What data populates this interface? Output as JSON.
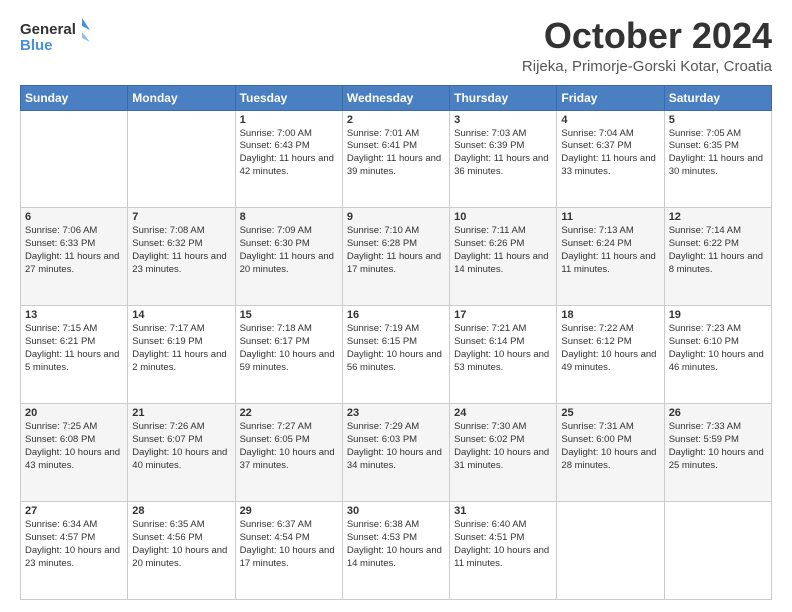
{
  "header": {
    "logo_line1": "General",
    "logo_line2": "Blue",
    "title": "October 2024",
    "subtitle": "Rijeka, Primorje-Gorski Kotar, Croatia"
  },
  "weekdays": [
    "Sunday",
    "Monday",
    "Tuesday",
    "Wednesday",
    "Thursday",
    "Friday",
    "Saturday"
  ],
  "weeks": [
    [
      {
        "day": "",
        "info": ""
      },
      {
        "day": "",
        "info": ""
      },
      {
        "day": "1",
        "info": "Sunrise: 7:00 AM\nSunset: 6:43 PM\nDaylight: 11 hours and 42 minutes."
      },
      {
        "day": "2",
        "info": "Sunrise: 7:01 AM\nSunset: 6:41 PM\nDaylight: 11 hours and 39 minutes."
      },
      {
        "day": "3",
        "info": "Sunrise: 7:03 AM\nSunset: 6:39 PM\nDaylight: 11 hours and 36 minutes."
      },
      {
        "day": "4",
        "info": "Sunrise: 7:04 AM\nSunset: 6:37 PM\nDaylight: 11 hours and 33 minutes."
      },
      {
        "day": "5",
        "info": "Sunrise: 7:05 AM\nSunset: 6:35 PM\nDaylight: 11 hours and 30 minutes."
      }
    ],
    [
      {
        "day": "6",
        "info": "Sunrise: 7:06 AM\nSunset: 6:33 PM\nDaylight: 11 hours and 27 minutes."
      },
      {
        "day": "7",
        "info": "Sunrise: 7:08 AM\nSunset: 6:32 PM\nDaylight: 11 hours and 23 minutes."
      },
      {
        "day": "8",
        "info": "Sunrise: 7:09 AM\nSunset: 6:30 PM\nDaylight: 11 hours and 20 minutes."
      },
      {
        "day": "9",
        "info": "Sunrise: 7:10 AM\nSunset: 6:28 PM\nDaylight: 11 hours and 17 minutes."
      },
      {
        "day": "10",
        "info": "Sunrise: 7:11 AM\nSunset: 6:26 PM\nDaylight: 11 hours and 14 minutes."
      },
      {
        "day": "11",
        "info": "Sunrise: 7:13 AM\nSunset: 6:24 PM\nDaylight: 11 hours and 11 minutes."
      },
      {
        "day": "12",
        "info": "Sunrise: 7:14 AM\nSunset: 6:22 PM\nDaylight: 11 hours and 8 minutes."
      }
    ],
    [
      {
        "day": "13",
        "info": "Sunrise: 7:15 AM\nSunset: 6:21 PM\nDaylight: 11 hours and 5 minutes."
      },
      {
        "day": "14",
        "info": "Sunrise: 7:17 AM\nSunset: 6:19 PM\nDaylight: 11 hours and 2 minutes."
      },
      {
        "day": "15",
        "info": "Sunrise: 7:18 AM\nSunset: 6:17 PM\nDaylight: 10 hours and 59 minutes."
      },
      {
        "day": "16",
        "info": "Sunrise: 7:19 AM\nSunset: 6:15 PM\nDaylight: 10 hours and 56 minutes."
      },
      {
        "day": "17",
        "info": "Sunrise: 7:21 AM\nSunset: 6:14 PM\nDaylight: 10 hours and 53 minutes."
      },
      {
        "day": "18",
        "info": "Sunrise: 7:22 AM\nSunset: 6:12 PM\nDaylight: 10 hours and 49 minutes."
      },
      {
        "day": "19",
        "info": "Sunrise: 7:23 AM\nSunset: 6:10 PM\nDaylight: 10 hours and 46 minutes."
      }
    ],
    [
      {
        "day": "20",
        "info": "Sunrise: 7:25 AM\nSunset: 6:08 PM\nDaylight: 10 hours and 43 minutes."
      },
      {
        "day": "21",
        "info": "Sunrise: 7:26 AM\nSunset: 6:07 PM\nDaylight: 10 hours and 40 minutes."
      },
      {
        "day": "22",
        "info": "Sunrise: 7:27 AM\nSunset: 6:05 PM\nDaylight: 10 hours and 37 minutes."
      },
      {
        "day": "23",
        "info": "Sunrise: 7:29 AM\nSunset: 6:03 PM\nDaylight: 10 hours and 34 minutes."
      },
      {
        "day": "24",
        "info": "Sunrise: 7:30 AM\nSunset: 6:02 PM\nDaylight: 10 hours and 31 minutes."
      },
      {
        "day": "25",
        "info": "Sunrise: 7:31 AM\nSunset: 6:00 PM\nDaylight: 10 hours and 28 minutes."
      },
      {
        "day": "26",
        "info": "Sunrise: 7:33 AM\nSunset: 5:59 PM\nDaylight: 10 hours and 25 minutes."
      }
    ],
    [
      {
        "day": "27",
        "info": "Sunrise: 6:34 AM\nSunset: 4:57 PM\nDaylight: 10 hours and 23 minutes."
      },
      {
        "day": "28",
        "info": "Sunrise: 6:35 AM\nSunset: 4:56 PM\nDaylight: 10 hours and 20 minutes."
      },
      {
        "day": "29",
        "info": "Sunrise: 6:37 AM\nSunset: 4:54 PM\nDaylight: 10 hours and 17 minutes."
      },
      {
        "day": "30",
        "info": "Sunrise: 6:38 AM\nSunset: 4:53 PM\nDaylight: 10 hours and 14 minutes."
      },
      {
        "day": "31",
        "info": "Sunrise: 6:40 AM\nSunset: 4:51 PM\nDaylight: 10 hours and 11 minutes."
      },
      {
        "day": "",
        "info": ""
      },
      {
        "day": "",
        "info": ""
      }
    ]
  ]
}
